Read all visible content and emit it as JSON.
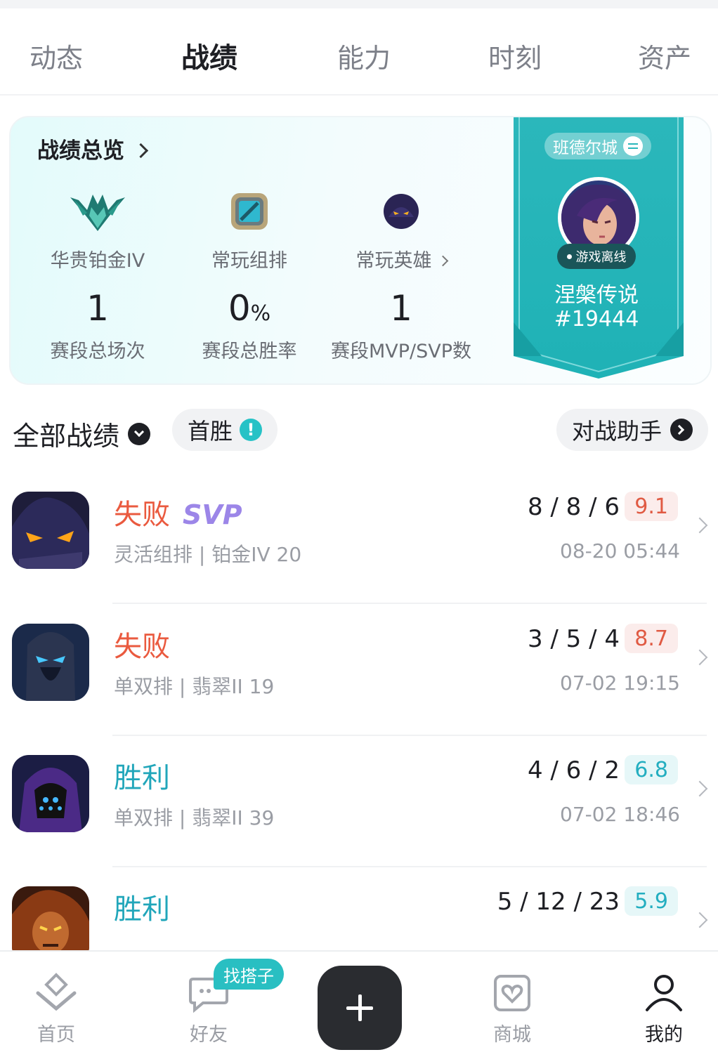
{
  "tabs": [
    {
      "label": "动态",
      "active": false
    },
    {
      "label": "战绩",
      "active": true
    },
    {
      "label": "能力",
      "active": false
    },
    {
      "label": "时刻",
      "active": false
    },
    {
      "label": "资产",
      "active": false
    }
  ],
  "summary": {
    "title": "战绩总览",
    "rank_label": "华贵铂金IV",
    "group_label": "常玩组排",
    "hero_label": "常玩英雄",
    "total_games": "1",
    "total_games_label": "赛段总场次",
    "win_rate": "0",
    "win_rate_unit": "%",
    "win_rate_label": "赛段总胜率",
    "mvp_count": "1",
    "mvp_label": "赛段MVP/SVP数"
  },
  "player": {
    "server": "班德尔城",
    "status": "游戏离线",
    "name": "涅槃传说",
    "tag": "#19444"
  },
  "filters": {
    "all_label": "全部战绩",
    "first_win_label": "首胜",
    "first_win_badge": "!",
    "assistant_label": "对战助手"
  },
  "matches": [
    {
      "result": "失败",
      "outcome": "loss",
      "badge": "SVP",
      "mode": "灵活组排 | 铂金IV 20",
      "kda": "8 / 8 / 6",
      "score": "9.1",
      "time": "08-20 05:44"
    },
    {
      "result": "失败",
      "outcome": "loss",
      "badge": "",
      "mode": "单双排 | 翡翠II 19",
      "kda": "3 / 5 / 4",
      "score": "8.7",
      "time": "07-02 19:15"
    },
    {
      "result": "胜利",
      "outcome": "win",
      "badge": "",
      "mode": "单双排 | 翡翠II 39",
      "kda": "4 / 6 / 2",
      "score": "6.8",
      "time": "07-02 18:46"
    },
    {
      "result": "胜利",
      "outcome": "win",
      "badge": "",
      "mode": "",
      "kda": "5 / 12 / 23",
      "score": "5.9",
      "time": ""
    }
  ],
  "nav": {
    "home": "首页",
    "friends": "好友",
    "friends_badge": "找搭子",
    "shop": "商城",
    "me": "我的"
  },
  "colors": {
    "accent_teal": "#29bfc2",
    "loss_red": "#ea5a3f",
    "win_teal": "#21a6ba",
    "svp_purple": "#9c86e8"
  }
}
